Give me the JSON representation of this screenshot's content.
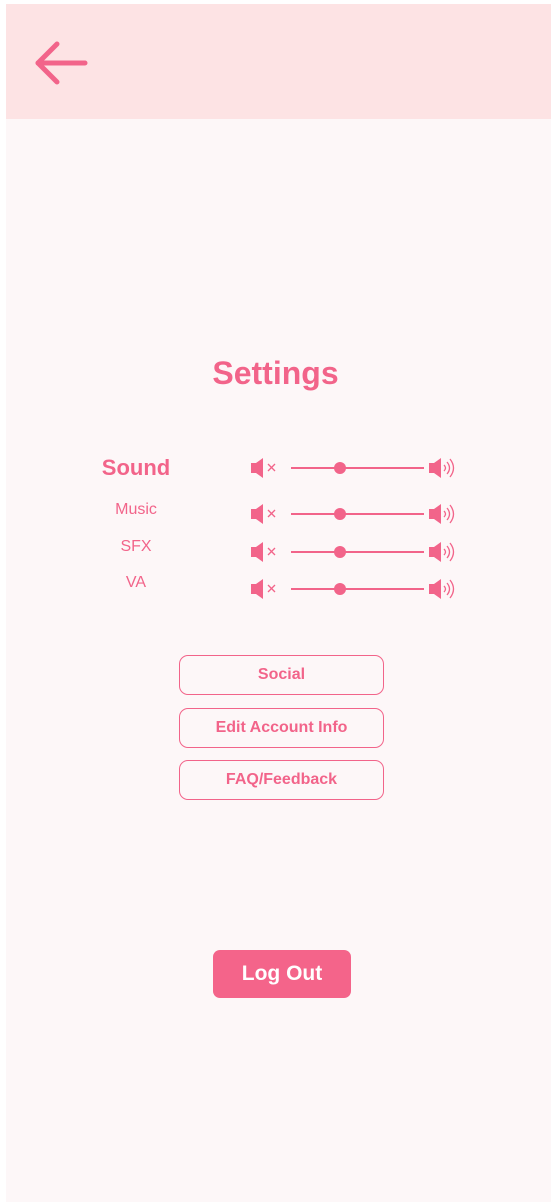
{
  "colors": {
    "accent": "#f2648a",
    "header_bg": "#fde3e4",
    "page_bg": "#fdf7f8",
    "button_fill": "#f4648a",
    "button_text": "#ffffff"
  },
  "header": {
    "back_icon": "arrow-left-icon"
  },
  "page": {
    "title": "Settings"
  },
  "sound": {
    "label": "Sound",
    "level": 0.37,
    "mute_icon": "volume-mute-icon",
    "max_icon": "volume-up-icon"
  },
  "channels": [
    {
      "label": "Music",
      "level": 0.37
    },
    {
      "label": "SFX",
      "level": 0.37
    },
    {
      "label": "VA",
      "level": 0.37
    }
  ],
  "menu": {
    "social": "Social",
    "edit_account": "Edit Account Info",
    "faq": "FAQ/Feedback"
  },
  "logout": {
    "label": "Log Out"
  }
}
